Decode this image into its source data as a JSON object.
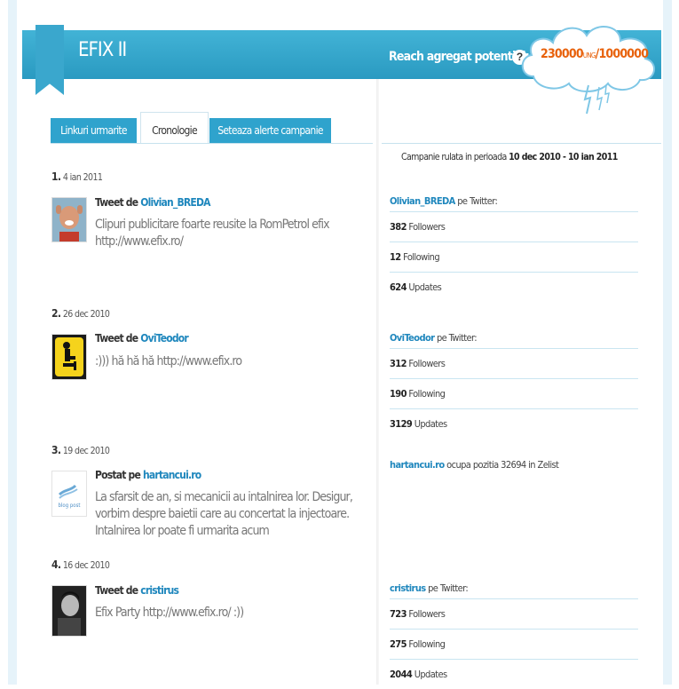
{
  "header": {
    "campaign_title": "EFIX II",
    "reach_label": "Reach agregat potential:",
    "help": "?",
    "reach_value": "230000",
    "reach_unit": "UNG",
    "reach_sep": "/",
    "reach_max": "1000000"
  },
  "tabs": [
    {
      "label": "Linkuri urmarite",
      "active": false
    },
    {
      "label": "Cronologie",
      "active": true
    },
    {
      "label": "Seteaza alerte campanie",
      "active": false
    }
  ],
  "period": {
    "prefix": "Campanie rulata in perioada",
    "range": "10 dec 2010 - 10 ian 2011"
  },
  "entries": [
    {
      "num": "1.",
      "date": "4 ian 2011",
      "kind": "Tweet de",
      "user": "Olivian_BREDA",
      "text": "Clipuri publicitare foarte reusite la RomPetrol efix http://www.efix.ro/"
    },
    {
      "num": "2.",
      "date": "26 dec 2010",
      "kind": "Tweet de",
      "user": "OviTeodor",
      "text": ":))) hă hă hă http://www.efix.ro"
    },
    {
      "num": "3.",
      "date": "19 dec 2010",
      "kind": "Postat pe",
      "user": "hartancui.ro",
      "text": "La sfarsit de an, si mecanicii au intalnirea lor. Desigur, vorbim despre baietii care au concertat la injectoare. Intalnirea lor poate fi urmarita acum"
    },
    {
      "num": "4.",
      "date": "16 dec 2010",
      "kind": "Tweet de",
      "user": "cristirus",
      "text": "Efix Party http://www.efix.ro/ :))"
    }
  ],
  "stats": [
    {
      "user": "Olivian_BREDA",
      "suffix": "pe Twitter:",
      "rows": [
        {
          "value": "382",
          "label": "Followers"
        },
        {
          "value": "12",
          "label": "Following"
        },
        {
          "value": "624",
          "label": "Updates"
        }
      ]
    },
    {
      "user": "OviTeodor",
      "suffix": "pe Twitter:",
      "rows": [
        {
          "value": "312",
          "label": "Followers"
        },
        {
          "value": "190",
          "label": "Following"
        },
        {
          "value": "3129",
          "label": "Updates"
        }
      ]
    },
    {
      "user": "hartancui.ro",
      "suffix": "ocupa pozitia 32694 in Zelist",
      "rows": []
    },
    {
      "user": "cristirus",
      "suffix": "pe Twitter:",
      "rows": [
        {
          "value": "723",
          "label": "Followers"
        },
        {
          "value": "275",
          "label": "Following"
        },
        {
          "value": "2044",
          "label": "Updates"
        }
      ]
    }
  ],
  "blog_logo_text": "blog post",
  "colors": {
    "accent": "#2fa3cd",
    "link": "#1f87bd",
    "reach": "#e8620c"
  }
}
